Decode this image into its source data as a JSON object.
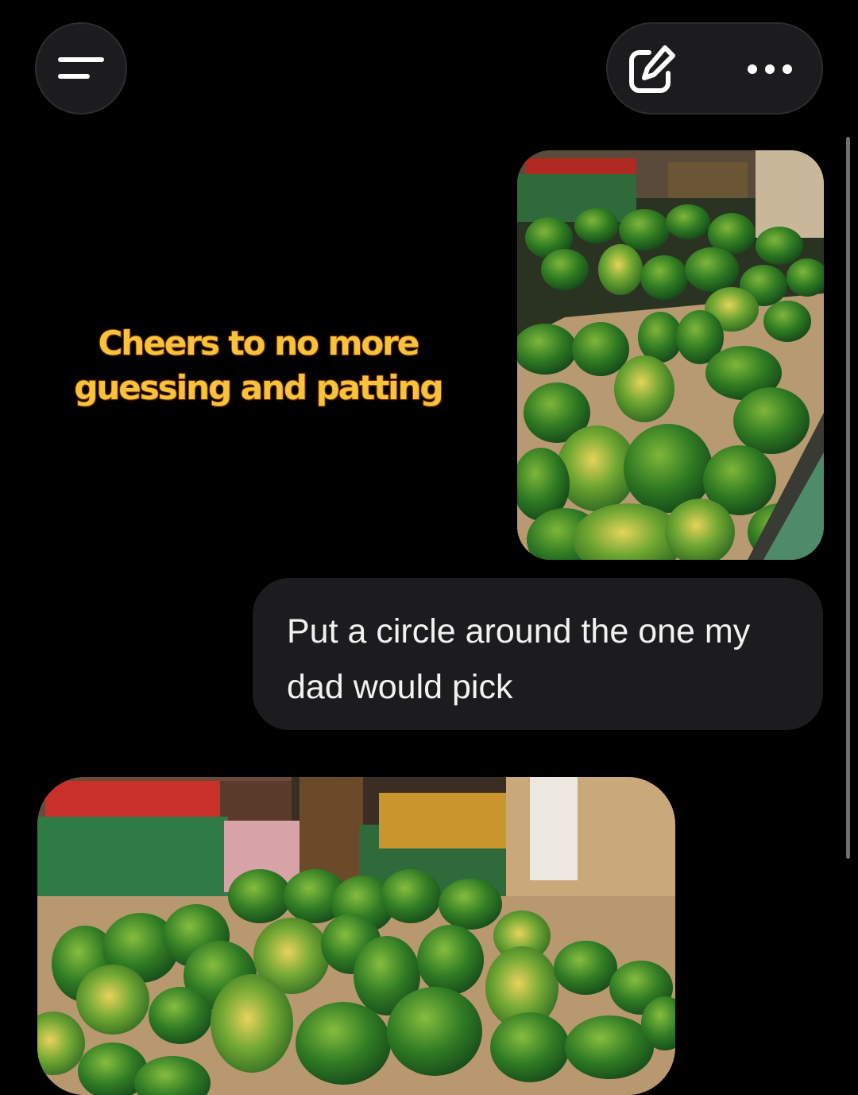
{
  "header": {
    "menu_icon": "menu-icon",
    "compose_icon": "compose-icon",
    "more_icon": "more-icon"
  },
  "conversation": {
    "caption": "Cheers to no more guessing and patting",
    "top_image": {
      "description_icon": "watermelon-photo"
    },
    "user_message": "Put a circle around the one my dad would pick",
    "bottom_image": {
      "description_icon": "watermelon-photo"
    }
  },
  "colors": {
    "background": "#000000",
    "bubble": "#1c1c1e",
    "caption_fill": "#f7c23c",
    "caption_outline": "#8a3d00"
  }
}
